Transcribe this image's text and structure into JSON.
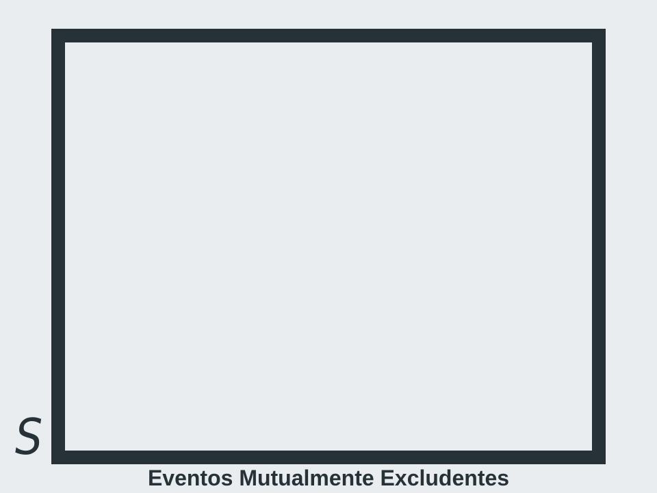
{
  "diagram": {
    "set_label": "S",
    "caption": "Eventos Mutualmente Excludentes"
  },
  "colors": {
    "background": "#e9edf0",
    "stroke": "#263238",
    "text": "#263238"
  }
}
